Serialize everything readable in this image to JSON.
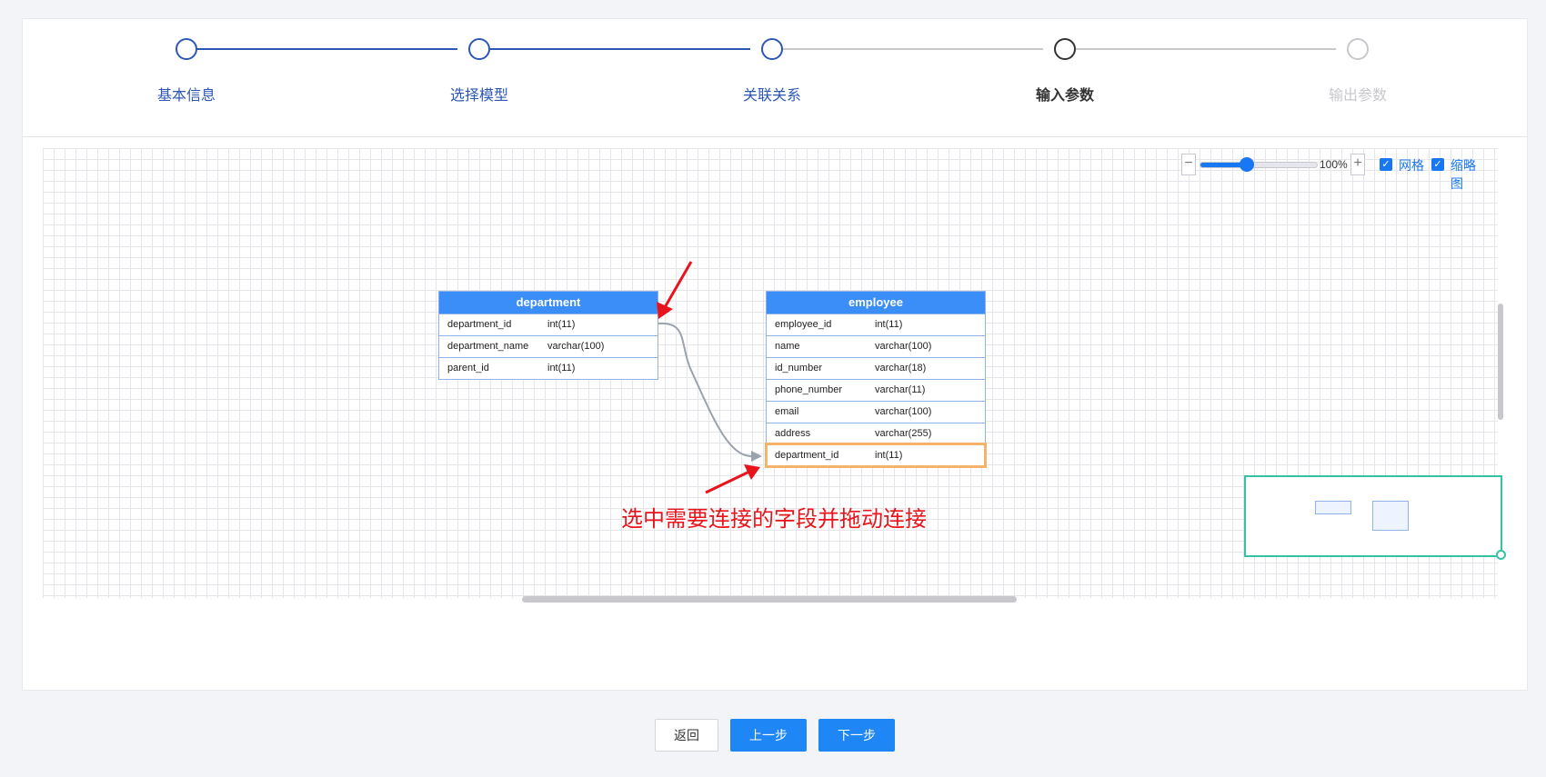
{
  "steps": [
    {
      "label": "基本信息",
      "state": "done"
    },
    {
      "label": "选择模型",
      "state": "done"
    },
    {
      "label": "关联关系",
      "state": "done"
    },
    {
      "label": "输入参数",
      "state": "current"
    },
    {
      "label": "输出参数",
      "state": "pending"
    }
  ],
  "toolbar": {
    "zoom_out": "−",
    "zoom_in": "+",
    "zoom_value": "100%",
    "zoom_level": 0.4,
    "grid_label": "网格",
    "grid_checked": true,
    "minimap_label": "缩略图",
    "minimap_checked": true
  },
  "tables": [
    {
      "name": "department",
      "fields": [
        {
          "name": "department_id",
          "type": "int(11)"
        },
        {
          "name": "department_name",
          "type": "varchar(100)"
        },
        {
          "name": "parent_id",
          "type": "int(11)"
        }
      ]
    },
    {
      "name": "employee",
      "fields": [
        {
          "name": "employee_id",
          "type": "int(11)"
        },
        {
          "name": "name",
          "type": "varchar(100)"
        },
        {
          "name": "id_number",
          "type": "varchar(18)"
        },
        {
          "name": "phone_number",
          "type": "varchar(11)"
        },
        {
          "name": "email",
          "type": "varchar(100)"
        },
        {
          "name": "address",
          "type": "varchar(255)"
        },
        {
          "name": "department_id",
          "type": "int(11)"
        }
      ]
    }
  ],
  "annotation": "选中需要连接的字段并拖动连接",
  "buttons": {
    "back": "返回",
    "prev": "上一步",
    "next": "下一步"
  },
  "colors": {
    "step_done": "#2c57b5",
    "step_current": "#333333",
    "step_pending": "#c8c8cc",
    "table_header": "#3b8ef7",
    "highlight": "#f5b36a",
    "annotation": "#e8141b",
    "minimap_border": "#32c2a6",
    "primary": "#1e86f5"
  }
}
